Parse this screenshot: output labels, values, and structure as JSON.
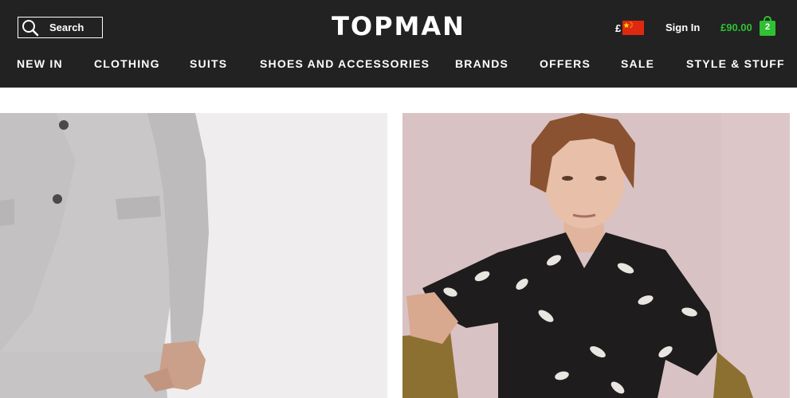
{
  "header": {
    "search_label": "Search",
    "logo": "TOPMAN",
    "currency_symbol": "£",
    "signin_label": "Sign In",
    "bag_total": "£90.00",
    "bag_count": "2"
  },
  "nav": {
    "items": [
      {
        "label": "NEW IN"
      },
      {
        "label": "CLOTHING"
      },
      {
        "label": "SUITS"
      },
      {
        "label": "SHOES AND ACCESSORIES"
      },
      {
        "label": "BRANDS"
      },
      {
        "label": "OFFERS"
      },
      {
        "label": "SALE"
      },
      {
        "label": "STYLE & STUFF"
      }
    ]
  },
  "colors": {
    "header_bg": "#222222",
    "bag_green": "#2fc132",
    "flag_red": "#de2910",
    "flag_yellow": "#ffde00"
  },
  "icons": {
    "search": "search-icon",
    "flag": "china-flag-icon",
    "bag": "shopping-bag-icon"
  }
}
